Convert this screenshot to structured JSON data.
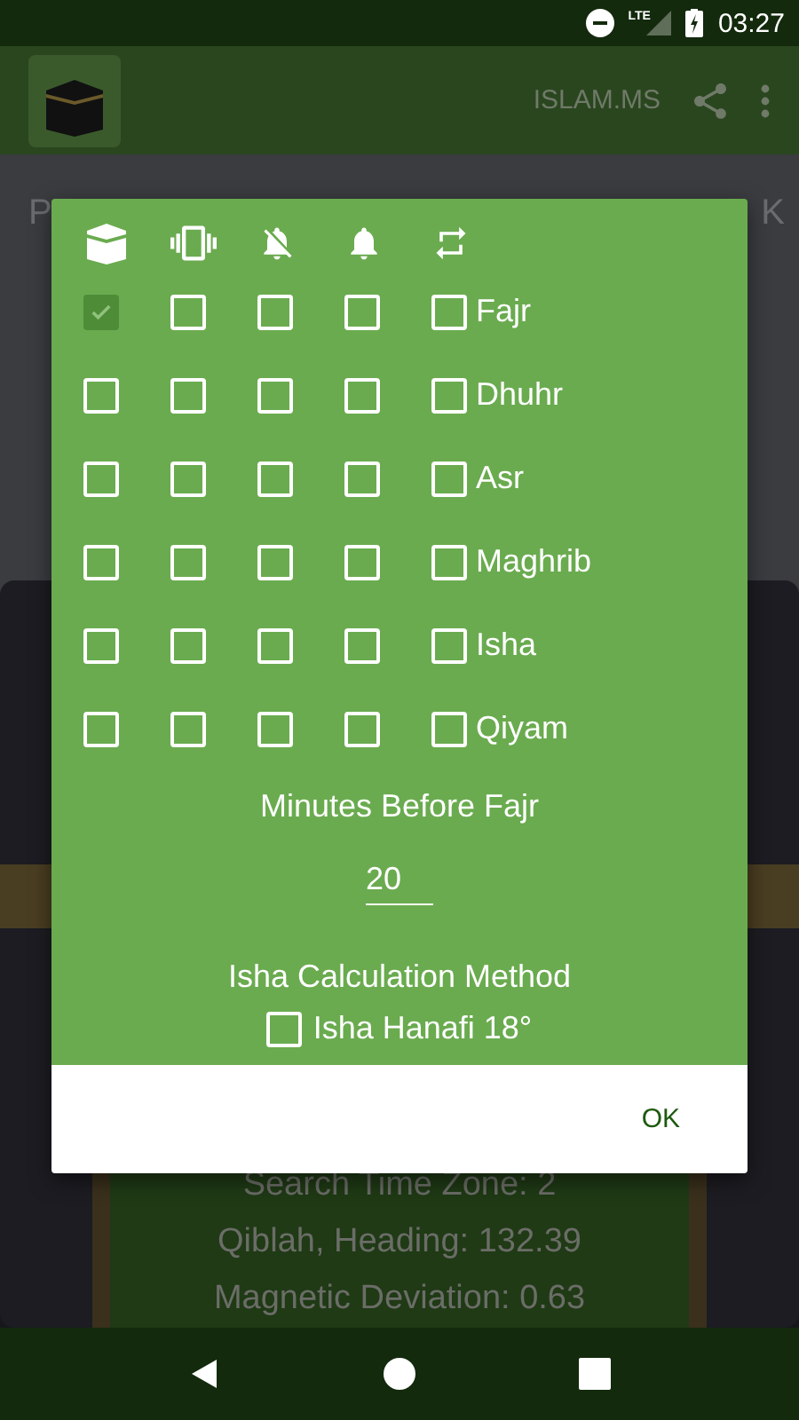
{
  "status_bar": {
    "time": "03:27",
    "network": "LTE"
  },
  "app_bar": {
    "title": "ISLAM.MS"
  },
  "background": {
    "left_fragment": "P",
    "right_fragment": "K",
    "lines": [
      "Search Time Zone: 2",
      "Qiblah, Heading: 132.39",
      "Magnetic Deviation: 0.63"
    ]
  },
  "dialog": {
    "rows": [
      {
        "label": "Fajr",
        "checks": [
          {
            "checked": true,
            "disabled": true
          },
          {
            "checked": false,
            "disabled": false
          },
          {
            "checked": false,
            "disabled": false
          },
          {
            "checked": false,
            "disabled": false
          },
          {
            "checked": false,
            "disabled": false
          }
        ]
      },
      {
        "label": "Dhuhr",
        "checks": [
          {
            "checked": false,
            "disabled": false
          },
          {
            "checked": false,
            "disabled": false
          },
          {
            "checked": false,
            "disabled": false
          },
          {
            "checked": false,
            "disabled": false
          },
          {
            "checked": false,
            "disabled": false
          }
        ]
      },
      {
        "label": "Asr",
        "checks": [
          {
            "checked": false,
            "disabled": false
          },
          {
            "checked": false,
            "disabled": false
          },
          {
            "checked": false,
            "disabled": false
          },
          {
            "checked": false,
            "disabled": false
          },
          {
            "checked": false,
            "disabled": false
          }
        ]
      },
      {
        "label": "Maghrib",
        "checks": [
          {
            "checked": false,
            "disabled": false
          },
          {
            "checked": false,
            "disabled": false
          },
          {
            "checked": false,
            "disabled": false
          },
          {
            "checked": false,
            "disabled": false
          },
          {
            "checked": false,
            "disabled": false
          }
        ]
      },
      {
        "label": "Isha",
        "checks": [
          {
            "checked": false,
            "disabled": false
          },
          {
            "checked": false,
            "disabled": false
          },
          {
            "checked": false,
            "disabled": false
          },
          {
            "checked": false,
            "disabled": false
          },
          {
            "checked": false,
            "disabled": false
          }
        ]
      },
      {
        "label": "Qiyam",
        "checks": [
          {
            "checked": false,
            "disabled": false
          },
          {
            "checked": false,
            "disabled": false
          },
          {
            "checked": false,
            "disabled": false
          },
          {
            "checked": false,
            "disabled": false
          },
          {
            "checked": false,
            "disabled": false
          }
        ]
      }
    ],
    "minutes_label": "Minutes Before Fajr",
    "minutes_value": "20",
    "method_label": "Isha Calculation Method",
    "method_option": {
      "label": "Isha Hanafi 18°",
      "checked": false
    },
    "ok_button": "OK"
  }
}
